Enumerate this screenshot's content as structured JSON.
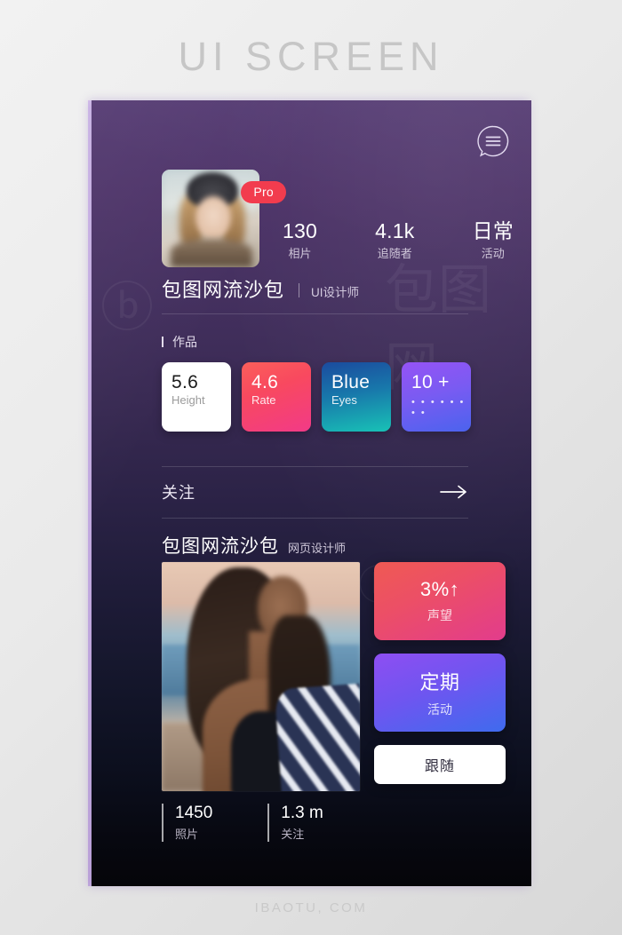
{
  "page": {
    "title": "UI SCREEN",
    "footer": "IBAOTU, COM"
  },
  "topbar": {
    "chat_icon": "chat-bubble-icon"
  },
  "profile": {
    "badge": "Pro",
    "avatar_alt": "profile-photo",
    "name": "包图网流沙包",
    "role": "UI设计师",
    "stats": [
      {
        "value": "130",
        "label": "相片"
      },
      {
        "value": "4.1k",
        "label": "追随者"
      },
      {
        "value": "日常",
        "label": "活动"
      }
    ]
  },
  "works": {
    "section_label": "作品",
    "cards": [
      {
        "value": "5.6",
        "label": "Height",
        "theme": "c-white",
        "dots": ""
      },
      {
        "value": "4.6",
        "label": "Rate",
        "theme": "c-pink",
        "dots": ""
      },
      {
        "value": "Blue",
        "label": "Eyes",
        "theme": "c-blue",
        "dots": ""
      },
      {
        "value": "10 +",
        "label": "",
        "theme": "c-violet",
        "dots": "• • • • • • • •"
      }
    ]
  },
  "follow_section": {
    "label": "关注",
    "arrow_icon": "arrow-right-icon"
  },
  "featured": {
    "name": "包图网流沙包",
    "role": "网页设计师",
    "photo_alt": "featured-photo",
    "side_cards": [
      {
        "value": "3%↑",
        "label": "声望",
        "theme": "sc-rep"
      },
      {
        "value": "定期",
        "label": "活动",
        "theme": "sc-act"
      }
    ],
    "follow_button": "跟随",
    "bottom_stats": [
      {
        "value": "1450",
        "label": "照片"
      },
      {
        "value": "1.3 m",
        "label": "关注"
      }
    ]
  },
  "colors": {
    "accent_red": "#f23c4e",
    "card_pink": "#f8495f",
    "card_blue": "#18c2b6",
    "card_violet": "#7a5bf2",
    "bg_purple": "#543a72",
    "bg_dark": "#050509"
  }
}
